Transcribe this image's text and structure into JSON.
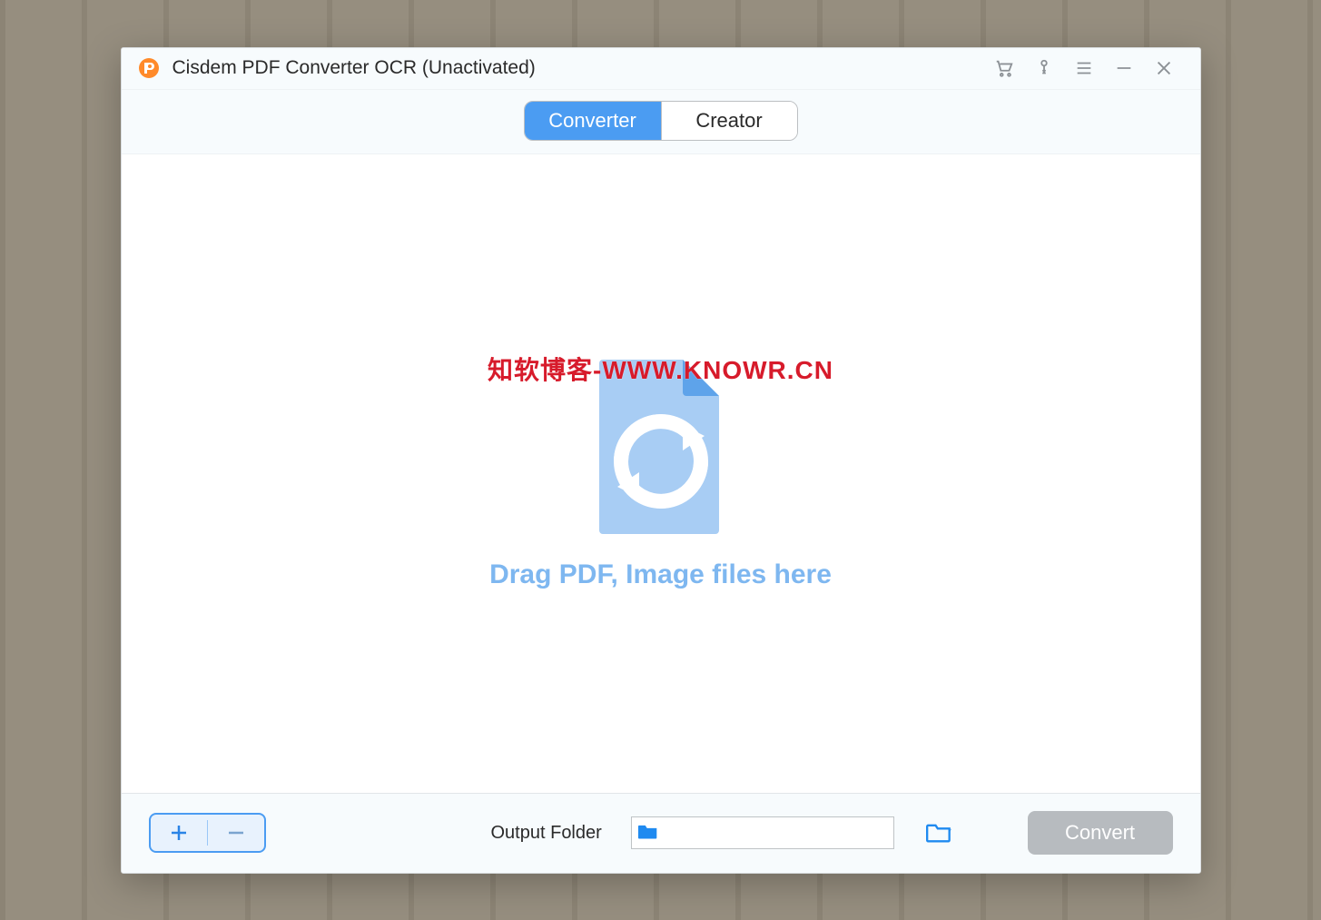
{
  "header": {
    "title": "Cisdem PDF Converter OCR (Unactivated)"
  },
  "tabs": {
    "converter_label": "Converter",
    "creator_label": "Creator",
    "active": "converter"
  },
  "drop": {
    "hint": "Drag PDF, Image files here"
  },
  "watermark": {
    "text": "知软博客-WWW.KNOWR.CN"
  },
  "bottom": {
    "output_label": "Output Folder",
    "output_value": "",
    "convert_label": "Convert"
  },
  "colors": {
    "accent": "#4b9cf2",
    "accent_soft": "#7eb7f0",
    "disabled": "#b7bbbf"
  }
}
